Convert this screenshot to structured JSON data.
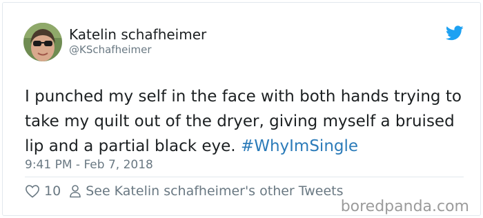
{
  "user": {
    "display_name": "Katelin schafheimer",
    "handle": "@KSchafheimer"
  },
  "tweet": {
    "text_before_hashtag": "I punched my self in the face with both hands trying to take my quilt out of the dryer, giving myself a bruised lip and a partial black eye. ",
    "hashtag": "#WhyImSingle",
    "timestamp": "9:41 PM - Feb 7, 2018"
  },
  "actions": {
    "like_count": "10",
    "other_tweets_label": "See Katelin schafheimer's other Tweets"
  },
  "watermark": "boredpanda.com",
  "icons": {
    "platform": "twitter-bird-icon",
    "like": "heart-icon",
    "profile": "person-icon"
  },
  "colors": {
    "hashtag": "#2b7bb9",
    "twitter_blue": "#1da1f2",
    "muted_text": "#697882"
  }
}
